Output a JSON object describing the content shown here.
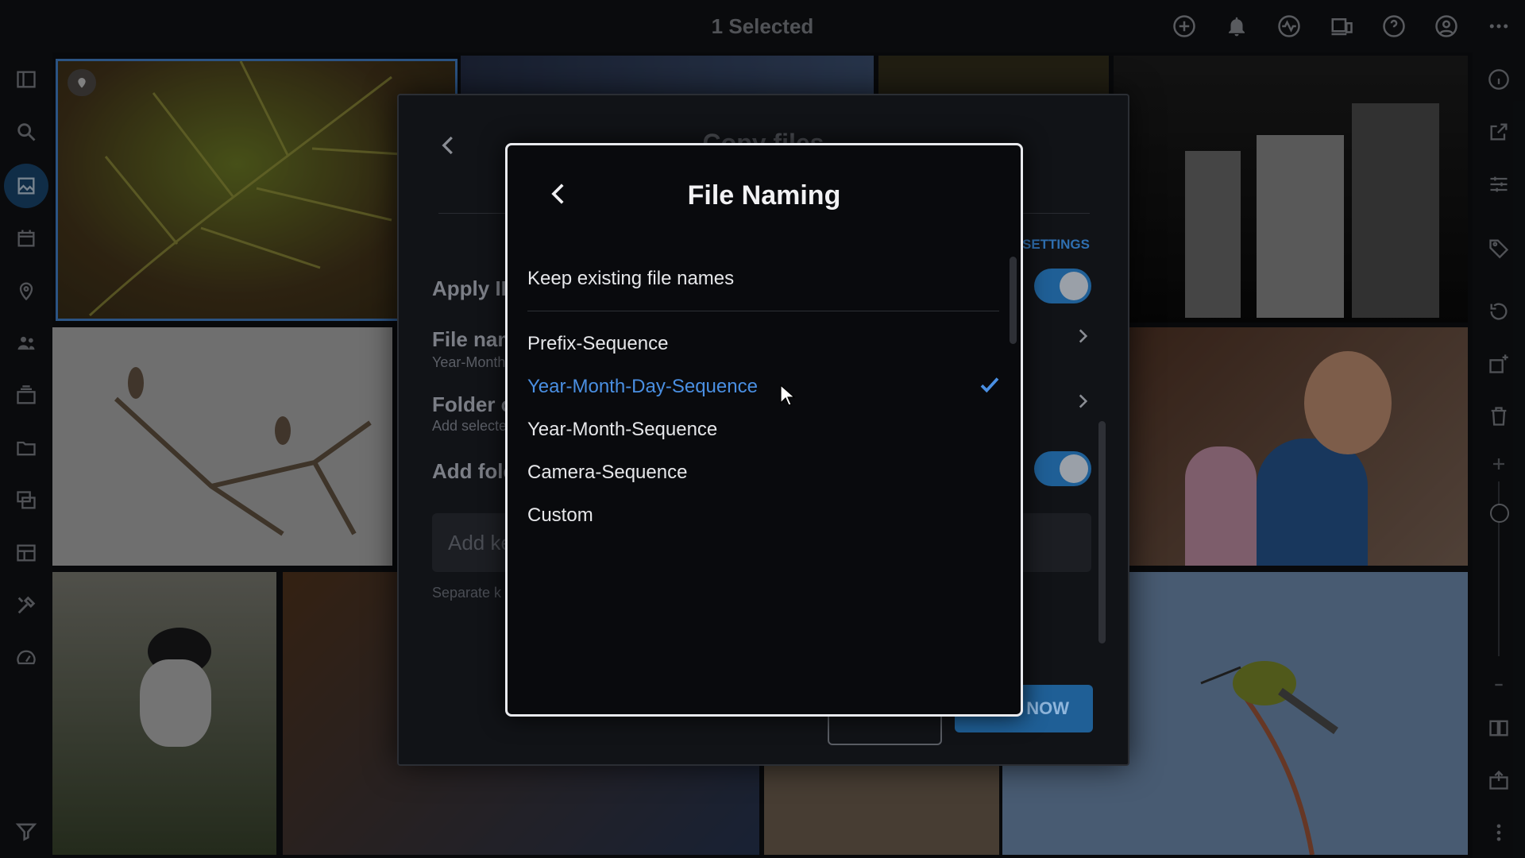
{
  "topbar": {
    "title": "1 Selected",
    "icons": [
      "add-icon",
      "bell-icon",
      "activity-icon",
      "devices-icon",
      "help-icon",
      "account-icon",
      "more-icon"
    ]
  },
  "left_rail": [
    "sidebar-toggle-icon",
    "search-icon",
    "photos-icon",
    "calendar-icon",
    "location-icon",
    "people-icon",
    "albums-icon",
    "folder-icon",
    "collections-icon",
    "layout-icon",
    "tools-icon",
    "speed-icon",
    "filter-icon"
  ],
  "right_rail": [
    "info-icon",
    "share-icon",
    "adjust-icon",
    "tag-icon",
    "rotate-icon",
    "add-photo-icon",
    "trash-icon",
    "zoom-in-icon",
    "zoom-out-icon",
    "book-icon",
    "export-icon",
    "more-vertical-icon"
  ],
  "copy_dialog": {
    "title": "Copy files",
    "settings_link": "SETTINGS",
    "rows": {
      "apply": "Apply IP",
      "file_naming": "File nam",
      "file_naming_sub": "Year-Month",
      "folder": "Folder o",
      "folder_sub": "Add selecte",
      "add_folder": "Add fold"
    },
    "keyword_placeholder": "Add ke",
    "keyword_hint": "Separate k",
    "primary_button": "NOW"
  },
  "file_naming_dialog": {
    "title": "File Naming",
    "keep_existing": "Keep existing file names",
    "options": [
      {
        "label": "Prefix-Sequence",
        "selected": false
      },
      {
        "label": "Year-Month-Day-Sequence",
        "selected": true
      },
      {
        "label": "Year-Month-Sequence",
        "selected": false
      },
      {
        "label": "Camera-Sequence",
        "selected": false
      },
      {
        "label": "Custom",
        "selected": false
      }
    ]
  },
  "colors": {
    "accent": "#4a8fe2",
    "toggle_on": "#1f5f96",
    "active_nav": "#1d4e7a"
  }
}
